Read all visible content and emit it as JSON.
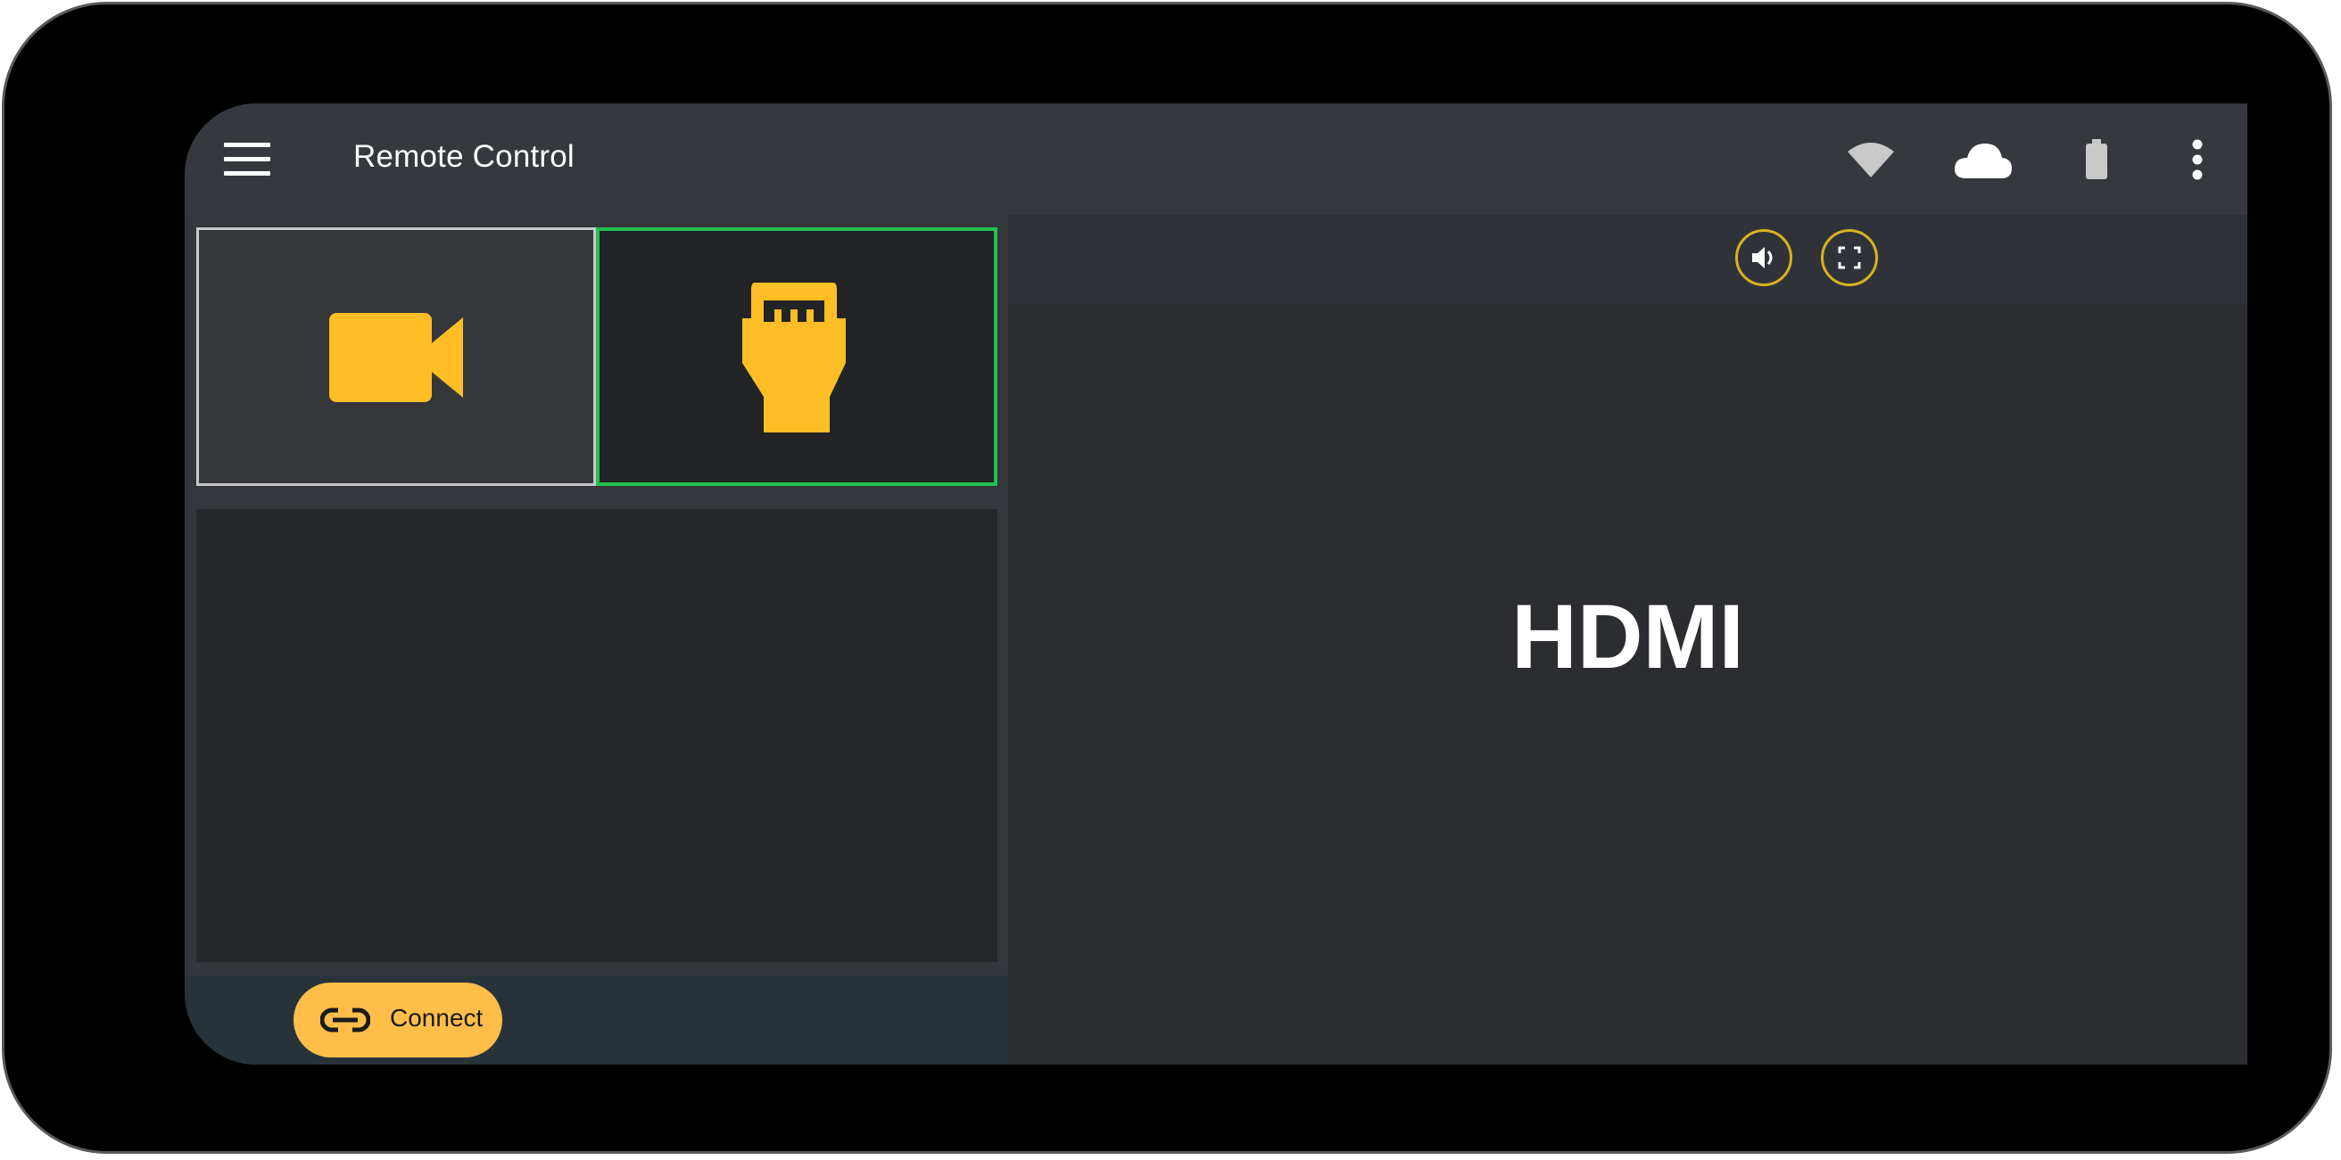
{
  "app": {
    "title": "Remote Control"
  },
  "topbar": {
    "menu_icon": "hamburger-menu-icon",
    "status_icons": [
      "wifi-icon",
      "cloud-icon",
      "battery-icon",
      "more-vertical-icon"
    ]
  },
  "sources": [
    {
      "name": "camera",
      "icon": "video-camera-icon",
      "selected": false
    },
    {
      "name": "hdmi",
      "icon": "hdmi-connector-icon",
      "selected": true
    }
  ],
  "connect_button": {
    "label": "Connect",
    "icon": "link-icon"
  },
  "preview_toolbar": {
    "buttons": [
      "volume-icon",
      "fullscreen-icon"
    ]
  },
  "main": {
    "active_source_label": "HDMI"
  },
  "colors": {
    "accent": "#ffbe4a",
    "icon_yellow": "#ffbe25",
    "selected_border": "#22c14f",
    "ring": "#d9b21f"
  }
}
